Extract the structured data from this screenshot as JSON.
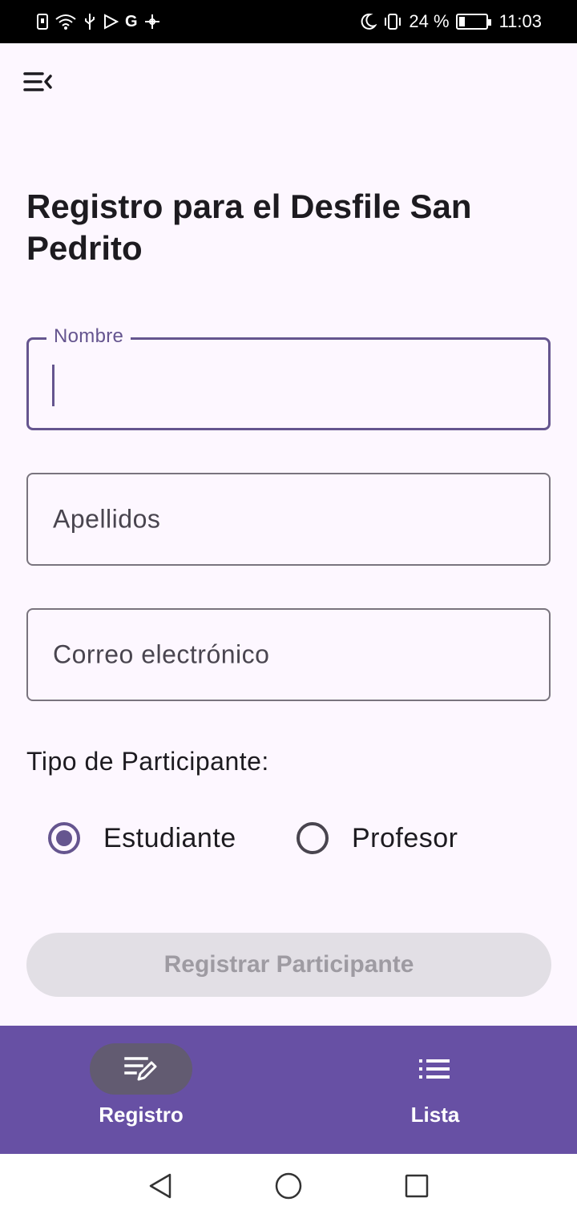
{
  "status_bar": {
    "battery_percent": "24 %",
    "time": "11:03",
    "battery_level": 0.24
  },
  "header": {
    "menu_icon": "menu-collapse-icon"
  },
  "page": {
    "title": "Registro para el Desfile San Pedrito"
  },
  "form": {
    "nombre": {
      "label": "Nombre",
      "value": ""
    },
    "apellidos": {
      "placeholder": "Apellidos",
      "value": ""
    },
    "correo": {
      "placeholder": "Correo electrónico",
      "value": ""
    },
    "participant_type_label": "Tipo de Participante:",
    "options": [
      {
        "label": "Estudiante",
        "selected": true
      },
      {
        "label": "Profesor",
        "selected": false
      }
    ],
    "submit_label": "Registrar Participante",
    "submit_enabled": false
  },
  "bottom_nav": {
    "items": [
      {
        "label": "Registro",
        "icon": "edit-note-icon",
        "active": true
      },
      {
        "label": "Lista",
        "icon": "list-icon",
        "active": false
      }
    ]
  },
  "colors": {
    "primary": "#65558F",
    "nav_background": "#6750A4",
    "background": "#FDF7FF"
  }
}
